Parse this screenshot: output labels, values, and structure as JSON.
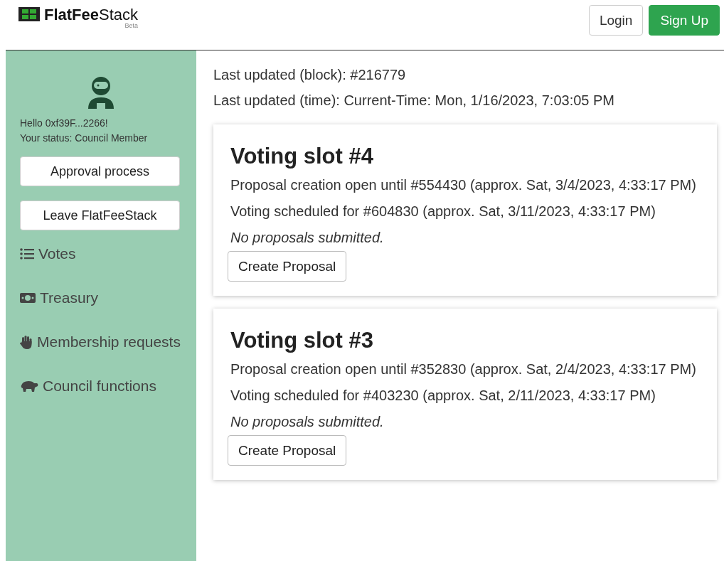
{
  "header": {
    "logo": "**FlatFee**Stack",
    "badge": "Beta",
    "buttons": [
      {
        "label": "Login",
        "kind": "outline"
      },
      {
        "label": "Sign Up",
        "kind": "primary"
      }
    ]
  },
  "sidebar": {
    "greeting": "Hello 0xf39F...2266!",
    "status": "Your status: Council Member",
    "buttons": [
      "Approval process",
      "Leave FlatFeeStack"
    ],
    "items": [
      {
        "label": "Votes",
        "kind": "list"
      },
      {
        "label": "Treasury",
        "kind": "money"
      },
      {
        "label": "Membership requests",
        "kind": "hand"
      },
      {
        "label": "Council functions",
        "kind": "hippo"
      }
    ]
  },
  "info": [
    "Last updated (block): #216779",
    "Last updated (time): Current-Time: Mon, 1/16/2023, 7:03:05 PM"
  ],
  "slots": [
    {
      "title": "Voting slot #4",
      "lines": [
        "Proposal creation open until #554430 (approx. Sat, 3/4/2023, 4:33:17 PM)",
        "Voting scheduled for #604830 (approx. Sat, 3/11/2023, 4:33:17 PM)"
      ],
      "note": "No proposals submitted.",
      "button": "Create Proposal"
    },
    {
      "title": "Voting slot #3",
      "lines": [
        "Proposal creation open until #352830 (approx. Sat, 2/4/2023, 4:33:17 PM)",
        "Voting scheduled for #403230 (approx. Sat, 2/11/2023, 4:33:17 PM)"
      ],
      "note": "No proposals submitted.",
      "button": "Create Proposal"
    }
  ]
}
